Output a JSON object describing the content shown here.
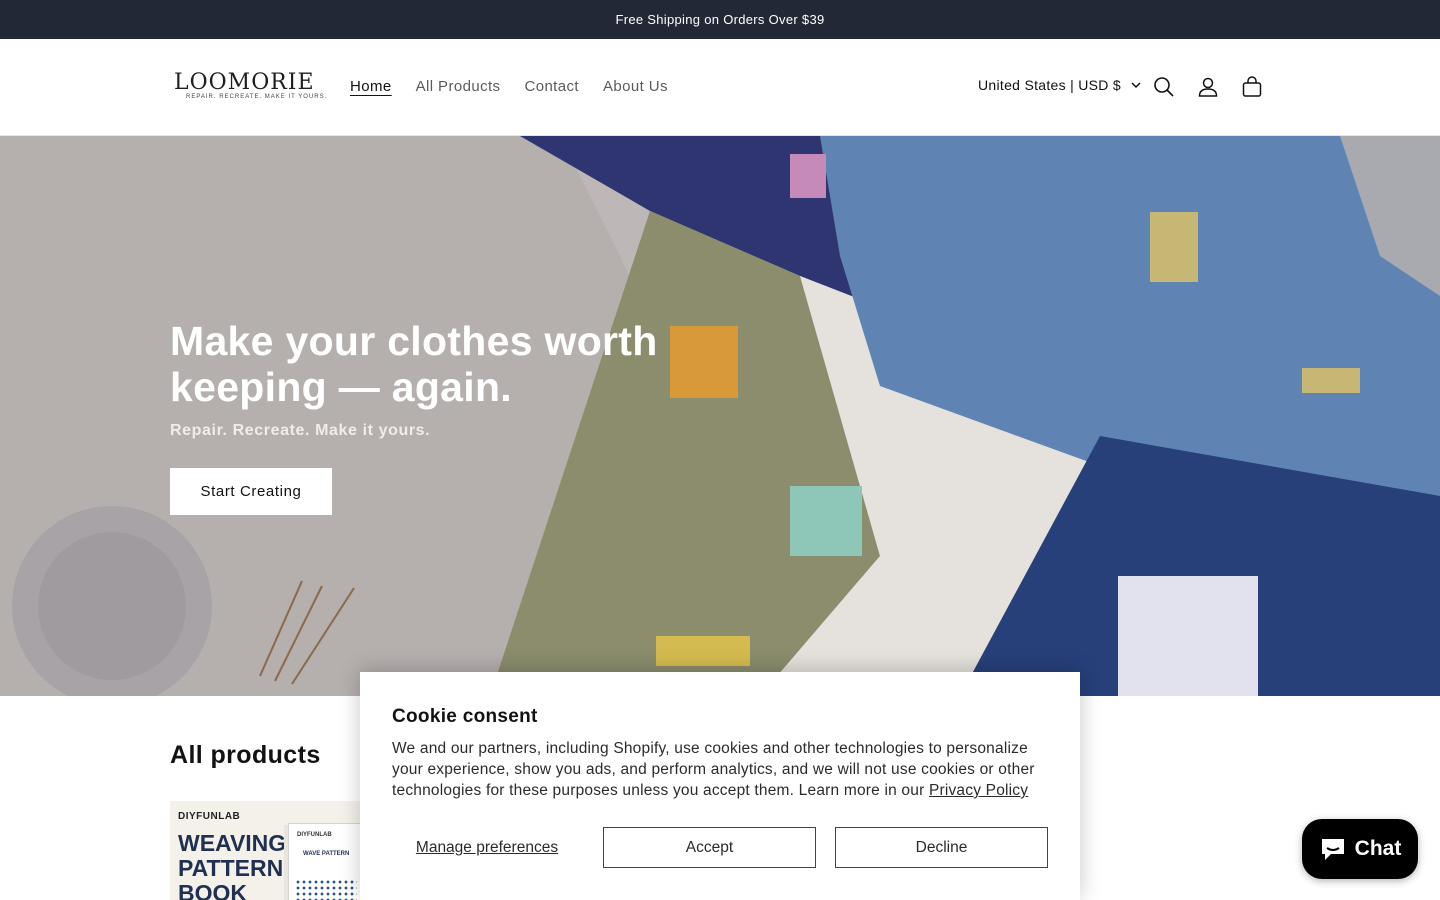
{
  "announcement": {
    "text": "Free Shipping on Orders Over $39"
  },
  "header": {
    "logo": {
      "wordmark": "LOOMORIE",
      "tagline": "REPAIR. RECREATE. MAKE IT YOURS."
    },
    "nav": [
      "Home",
      "All Products",
      "Contact",
      "About Us"
    ],
    "active_nav": "Home",
    "country_selector": "United States | USD $",
    "icons": [
      "search-icon",
      "account-icon",
      "cart-icon"
    ]
  },
  "hero": {
    "title": "Make your clothes worth keeping — again.",
    "subtitle": "Repair. Recreate. Make it yours.",
    "cta": "Start Creating"
  },
  "products_section": {
    "title": "All products",
    "first_product": {
      "brand": "DIYFUNLAB",
      "cover_title": "WEAVING PATTERN BOOK",
      "sheet_brand": "DIYFUNLAB",
      "sheet_title": "WAVE PATTERN"
    }
  },
  "cookie_banner": {
    "title": "Cookie consent",
    "body": "We and our partners, including Shopify, use cookies and other technologies to personalize your experience, show you ads, and perform analytics, and we will not use cookies or other technologies for these purposes unless you accept them. Learn more in our ",
    "link": "Privacy Policy",
    "manage": "Manage preferences",
    "accept": "Accept",
    "decline": "Decline"
  },
  "chat_widget": {
    "label": "Chat",
    "icon": "chat-bubble-icon"
  },
  "colors": {
    "announcement_bg": "#232837",
    "denim_light": "#5f84b4",
    "denim_dark": "#27407a",
    "olive": "#8b8d6d",
    "chat_bg": "#000000"
  }
}
